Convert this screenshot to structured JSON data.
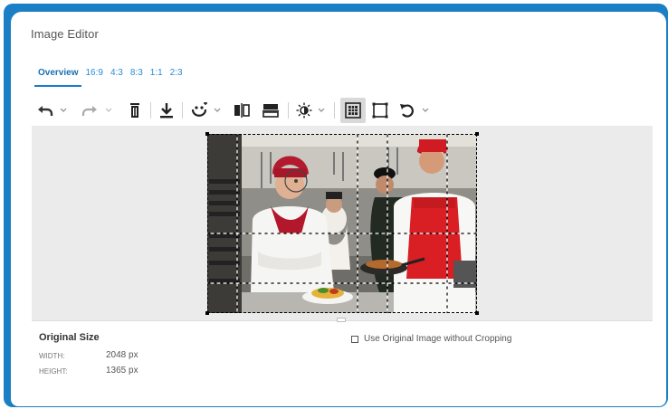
{
  "dialog": {
    "title": "Image Editor"
  },
  "tabs": [
    {
      "label": "Overview",
      "active": true
    },
    {
      "label": "16:9"
    },
    {
      "label": "4:3"
    },
    {
      "label": "8:3"
    },
    {
      "label": "1:1"
    },
    {
      "label": "2:3"
    }
  ],
  "toolbar": {
    "icons": [
      "undo-icon",
      "chevron-down-icon",
      "redo-icon",
      "chevron-down-icon",
      "delete-icon",
      "download-icon",
      "face-detect-icon",
      "chevron-down-icon",
      "flip-horizontal-icon",
      "flip-vertical-icon",
      "brightness-icon",
      "chevron-down-icon",
      "grid-icon",
      "crop-icon",
      "rotate-icon",
      "chevron-down-icon"
    ]
  },
  "info": {
    "heading": "Original Size",
    "width_label": "WIDTH:",
    "width_value": "2048 px",
    "height_label": "HEIGHT:",
    "height_value": "1365 px",
    "checkbox_label": "Use Original Image without Cropping",
    "checkbox_checked": false
  },
  "colors": {
    "accent": "#1a7fc4",
    "tab_text": "#2a8bd4",
    "canvas_bg": "#ebebeb"
  }
}
